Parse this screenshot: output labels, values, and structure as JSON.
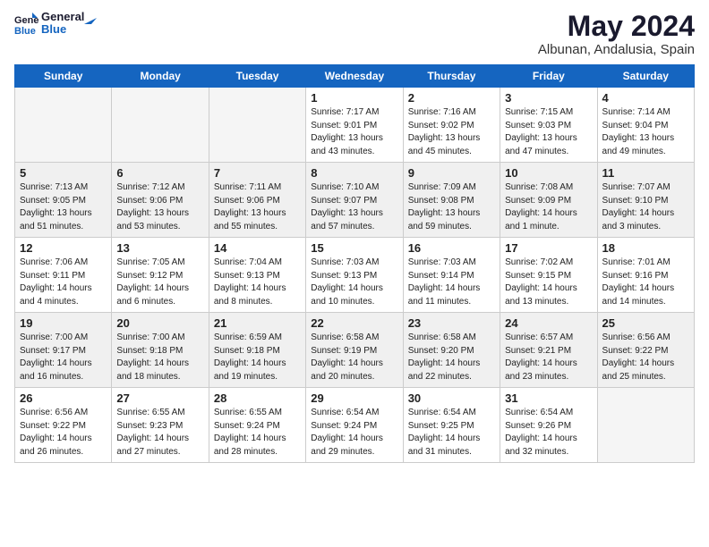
{
  "logo": {
    "text_general": "General",
    "text_blue": "Blue"
  },
  "header": {
    "month_year": "May 2024",
    "location": "Albunan, Andalusia, Spain"
  },
  "days_of_week": [
    "Sunday",
    "Monday",
    "Tuesday",
    "Wednesday",
    "Thursday",
    "Friday",
    "Saturday"
  ],
  "weeks": [
    {
      "shade": false,
      "days": [
        {
          "num": "",
          "empty": true
        },
        {
          "num": "",
          "empty": true
        },
        {
          "num": "",
          "empty": true
        },
        {
          "num": "1",
          "empty": false,
          "sunrise": "7:17 AM",
          "sunset": "9:01 PM",
          "daylight": "13 hours and 43 minutes."
        },
        {
          "num": "2",
          "empty": false,
          "sunrise": "7:16 AM",
          "sunset": "9:02 PM",
          "daylight": "13 hours and 45 minutes."
        },
        {
          "num": "3",
          "empty": false,
          "sunrise": "7:15 AM",
          "sunset": "9:03 PM",
          "daylight": "13 hours and 47 minutes."
        },
        {
          "num": "4",
          "empty": false,
          "sunrise": "7:14 AM",
          "sunset": "9:04 PM",
          "daylight": "13 hours and 49 minutes."
        }
      ]
    },
    {
      "shade": true,
      "days": [
        {
          "num": "5",
          "empty": false,
          "sunrise": "7:13 AM",
          "sunset": "9:05 PM",
          "daylight": "13 hours and 51 minutes."
        },
        {
          "num": "6",
          "empty": false,
          "sunrise": "7:12 AM",
          "sunset": "9:06 PM",
          "daylight": "13 hours and 53 minutes."
        },
        {
          "num": "7",
          "empty": false,
          "sunrise": "7:11 AM",
          "sunset": "9:06 PM",
          "daylight": "13 hours and 55 minutes."
        },
        {
          "num": "8",
          "empty": false,
          "sunrise": "7:10 AM",
          "sunset": "9:07 PM",
          "daylight": "13 hours and 57 minutes."
        },
        {
          "num": "9",
          "empty": false,
          "sunrise": "7:09 AM",
          "sunset": "9:08 PM",
          "daylight": "13 hours and 59 minutes."
        },
        {
          "num": "10",
          "empty": false,
          "sunrise": "7:08 AM",
          "sunset": "9:09 PM",
          "daylight": "14 hours and 1 minute."
        },
        {
          "num": "11",
          "empty": false,
          "sunrise": "7:07 AM",
          "sunset": "9:10 PM",
          "daylight": "14 hours and 3 minutes."
        }
      ]
    },
    {
      "shade": false,
      "days": [
        {
          "num": "12",
          "empty": false,
          "sunrise": "7:06 AM",
          "sunset": "9:11 PM",
          "daylight": "14 hours and 4 minutes."
        },
        {
          "num": "13",
          "empty": false,
          "sunrise": "7:05 AM",
          "sunset": "9:12 PM",
          "daylight": "14 hours and 6 minutes."
        },
        {
          "num": "14",
          "empty": false,
          "sunrise": "7:04 AM",
          "sunset": "9:13 PM",
          "daylight": "14 hours and 8 minutes."
        },
        {
          "num": "15",
          "empty": false,
          "sunrise": "7:03 AM",
          "sunset": "9:13 PM",
          "daylight": "14 hours and 10 minutes."
        },
        {
          "num": "16",
          "empty": false,
          "sunrise": "7:03 AM",
          "sunset": "9:14 PM",
          "daylight": "14 hours and 11 minutes."
        },
        {
          "num": "17",
          "empty": false,
          "sunrise": "7:02 AM",
          "sunset": "9:15 PM",
          "daylight": "14 hours and 13 minutes."
        },
        {
          "num": "18",
          "empty": false,
          "sunrise": "7:01 AM",
          "sunset": "9:16 PM",
          "daylight": "14 hours and 14 minutes."
        }
      ]
    },
    {
      "shade": true,
      "days": [
        {
          "num": "19",
          "empty": false,
          "sunrise": "7:00 AM",
          "sunset": "9:17 PM",
          "daylight": "14 hours and 16 minutes."
        },
        {
          "num": "20",
          "empty": false,
          "sunrise": "7:00 AM",
          "sunset": "9:18 PM",
          "daylight": "14 hours and 18 minutes."
        },
        {
          "num": "21",
          "empty": false,
          "sunrise": "6:59 AM",
          "sunset": "9:18 PM",
          "daylight": "14 hours and 19 minutes."
        },
        {
          "num": "22",
          "empty": false,
          "sunrise": "6:58 AM",
          "sunset": "9:19 PM",
          "daylight": "14 hours and 20 minutes."
        },
        {
          "num": "23",
          "empty": false,
          "sunrise": "6:58 AM",
          "sunset": "9:20 PM",
          "daylight": "14 hours and 22 minutes."
        },
        {
          "num": "24",
          "empty": false,
          "sunrise": "6:57 AM",
          "sunset": "9:21 PM",
          "daylight": "14 hours and 23 minutes."
        },
        {
          "num": "25",
          "empty": false,
          "sunrise": "6:56 AM",
          "sunset": "9:22 PM",
          "daylight": "14 hours and 25 minutes."
        }
      ]
    },
    {
      "shade": false,
      "days": [
        {
          "num": "26",
          "empty": false,
          "sunrise": "6:56 AM",
          "sunset": "9:22 PM",
          "daylight": "14 hours and 26 minutes."
        },
        {
          "num": "27",
          "empty": false,
          "sunrise": "6:55 AM",
          "sunset": "9:23 PM",
          "daylight": "14 hours and 27 minutes."
        },
        {
          "num": "28",
          "empty": false,
          "sunrise": "6:55 AM",
          "sunset": "9:24 PM",
          "daylight": "14 hours and 28 minutes."
        },
        {
          "num": "29",
          "empty": false,
          "sunrise": "6:54 AM",
          "sunset": "9:24 PM",
          "daylight": "14 hours and 29 minutes."
        },
        {
          "num": "30",
          "empty": false,
          "sunrise": "6:54 AM",
          "sunset": "9:25 PM",
          "daylight": "14 hours and 31 minutes."
        },
        {
          "num": "31",
          "empty": false,
          "sunrise": "6:54 AM",
          "sunset": "9:26 PM",
          "daylight": "14 hours and 32 minutes."
        },
        {
          "num": "",
          "empty": true
        }
      ]
    }
  ],
  "labels": {
    "sunrise_prefix": "Sunrise: ",
    "sunset_prefix": "Sunset: ",
    "daylight_prefix": "Daylight: "
  }
}
